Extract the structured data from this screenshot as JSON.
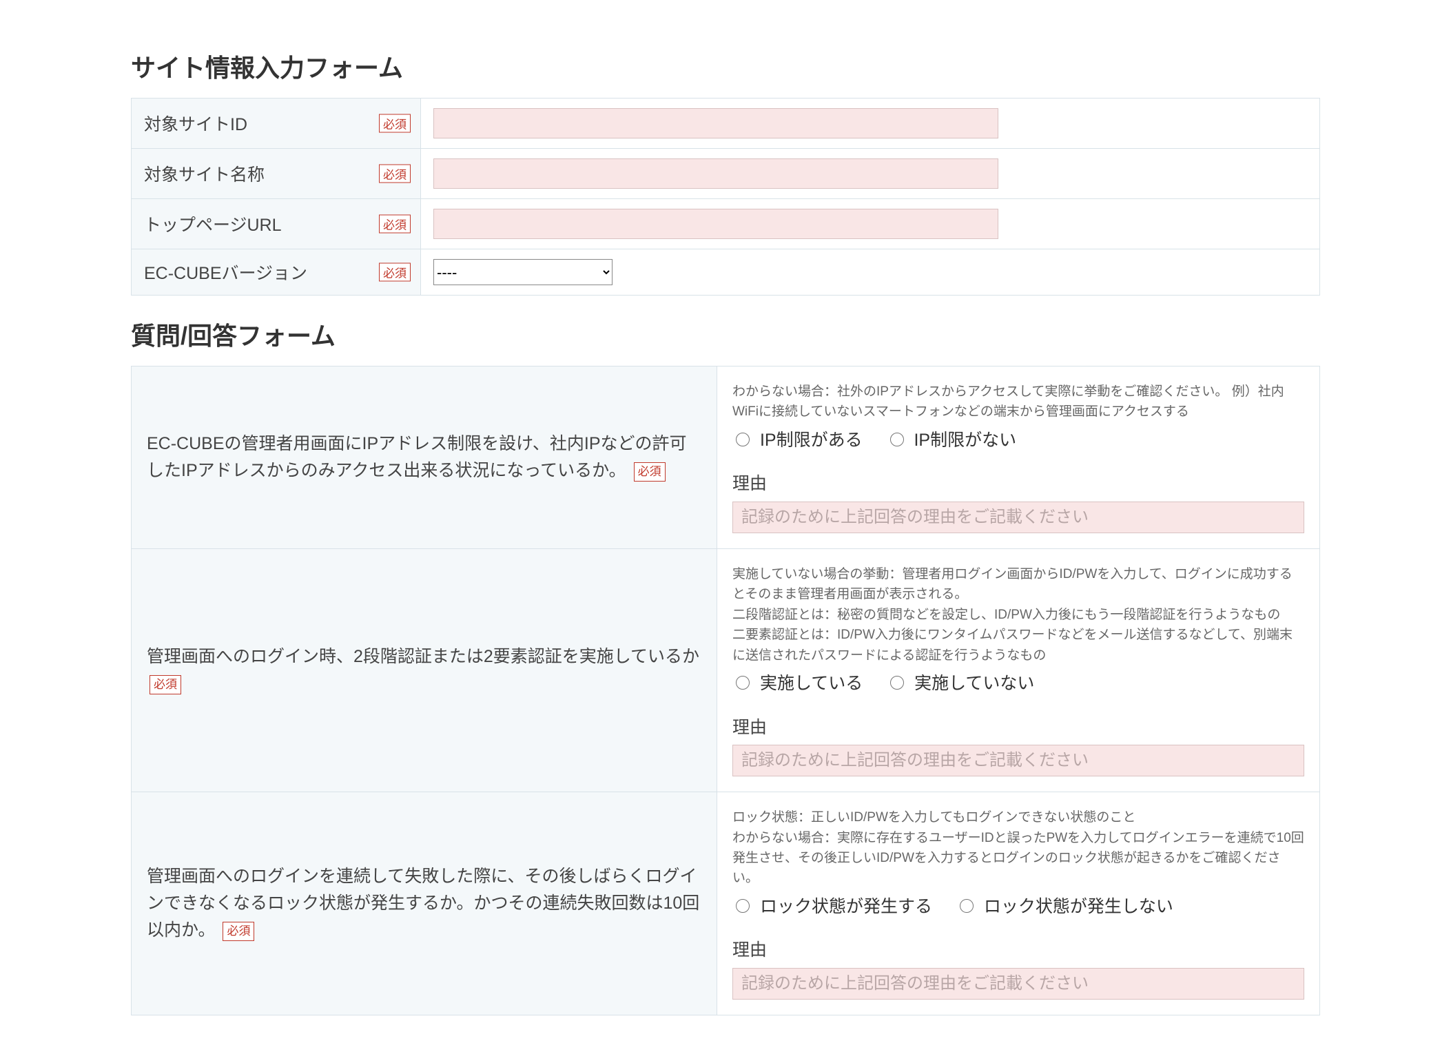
{
  "section1": {
    "title": "サイト情報入力フォーム",
    "required_badge": "必須",
    "fields": {
      "site_id": {
        "label": "対象サイトID",
        "value": ""
      },
      "site_name": {
        "label": "対象サイト名称",
        "value": ""
      },
      "top_url": {
        "label": "トップページURL",
        "value": ""
      },
      "eccube_version": {
        "label": "EC-CUBEバージョン",
        "selected": "----"
      }
    }
  },
  "section2": {
    "title": "質問/回答フォーム",
    "reason_label": "理由",
    "reason_placeholder": "記録のために上記回答の理由をご記載ください",
    "required_badge": "必須",
    "q1": {
      "text": "EC-CUBEの管理者用画面にIPアドレス制限を設け、社内IPなどの許可したIPアドレスからのみアクセス出来る状況になっているか。",
      "hint": "わからない場合：社外のIPアドレスからアクセスして実際に挙動をご確認ください。 例）社内WiFiに接続していないスマートフォンなどの端末から管理画面にアクセスする",
      "opt1": "IP制限がある",
      "opt2": "IP制限がない"
    },
    "q2": {
      "text": "管理画面へのログイン時、2段階認証または2要素認証を実施しているか",
      "hint": "実施していない場合の挙動：管理者用ログイン画面からID/PWを入力して、ログインに成功するとそのまま管理者用画面が表示される。\n二段階認証とは：秘密の質問などを設定し、ID/PW入力後にもう一段階認証を行うようなもの\n二要素認証とは：ID/PW入力後にワンタイムパスワードなどをメール送信するなどして、別端末に送信されたパスワードによる認証を行うようなもの",
      "opt1": "実施している",
      "opt2": "実施していない"
    },
    "q3": {
      "text": "管理画面へのログインを連続して失敗した際に、その後しばらくログインできなくなるロック状態が発生するか。かつその連続失敗回数は10回以内か。",
      "hint": "ロック状態：正しいID/PWを入力してもログインできない状態のこと\nわからない場合：実際に存在するユーザーIDと誤ったPWを入力してログインエラーを連続で10回発生させ、その後正しいID/PWを入力するとログインのロック状態が起きるかをご確認ください。",
      "opt1": "ロック状態が発生する",
      "opt2": "ロック状態が発生しない"
    }
  }
}
